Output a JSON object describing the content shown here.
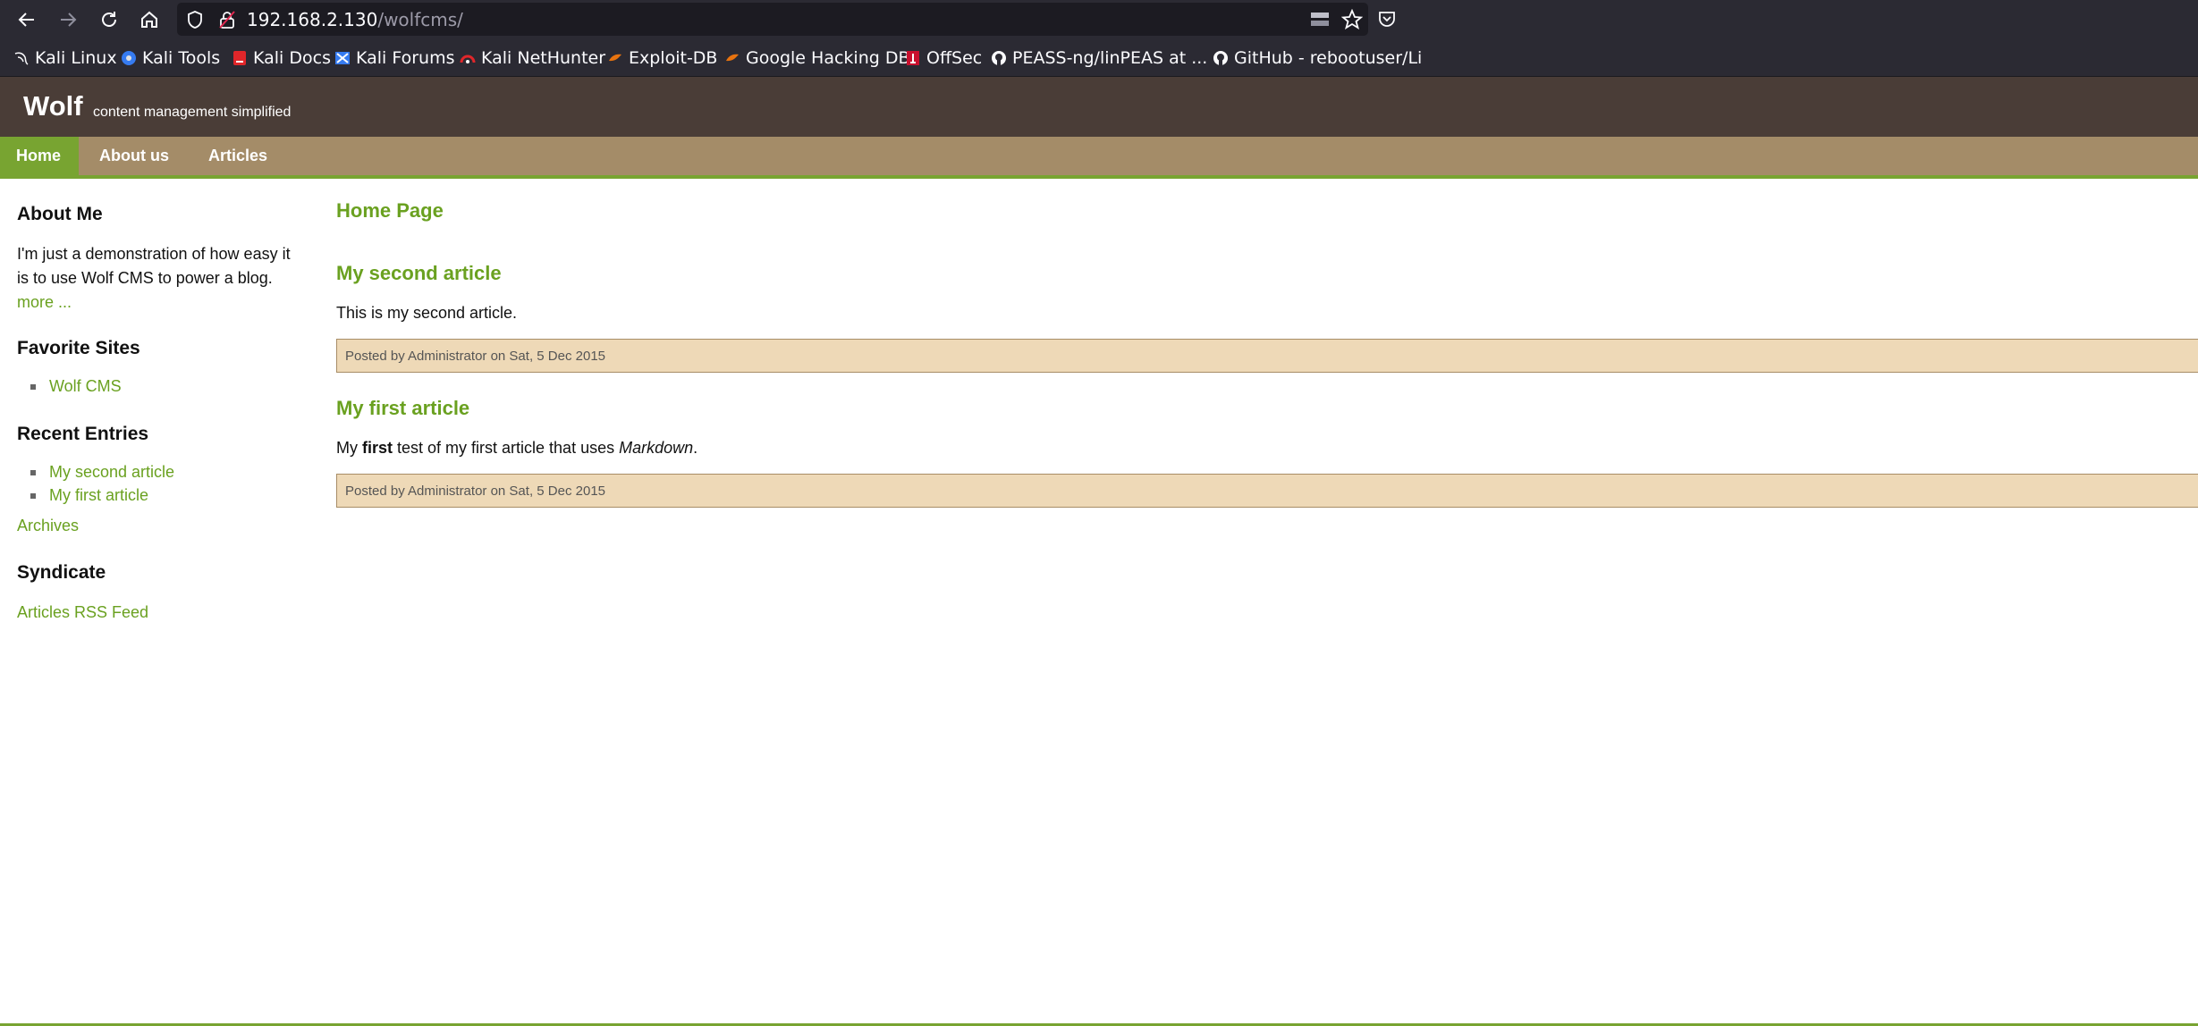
{
  "browser": {
    "url_host": "192.168.2.130",
    "url_path": "/wolfcms/",
    "bookmarks": [
      {
        "label": "Kali Linux",
        "icon": "kali-dragon-icon"
      },
      {
        "label": "Kali Tools",
        "icon": "kali-tools-icon"
      },
      {
        "label": "Kali Docs",
        "icon": "kali-docs-icon"
      },
      {
        "label": "Kali Forums",
        "icon": "kali-forums-icon"
      },
      {
        "label": "Kali NetHunter",
        "icon": "nethunter-icon"
      },
      {
        "label": "Exploit-DB",
        "icon": "exploit-db-icon"
      },
      {
        "label": "Google Hacking DB",
        "icon": "ghdb-icon"
      },
      {
        "label": "OffSec",
        "icon": "offsec-icon"
      },
      {
        "label": "PEASS-ng/linPEAS at ...",
        "icon": "github-icon"
      },
      {
        "label": "GitHub - rebootuser/Li",
        "icon": "github-icon"
      }
    ]
  },
  "site": {
    "title": "Wolf",
    "slogan": "content management simplified",
    "nav": [
      {
        "label": "Home",
        "active": true
      },
      {
        "label": "About us",
        "active": false
      },
      {
        "label": "Articles",
        "active": false
      }
    ]
  },
  "sidebar": {
    "about_heading": "About Me",
    "about_text": "I'm just a demonstration of how easy it is to use Wolf CMS to power a blog.",
    "about_more": "more ...",
    "favorites_heading": "Favorite Sites",
    "favorites": [
      "Wolf CMS"
    ],
    "recent_heading": "Recent Entries",
    "recent": [
      "My second article",
      "My first article"
    ],
    "archives": "Archives",
    "syndicate_heading": "Syndicate",
    "rss": "Articles RSS Feed"
  },
  "content": {
    "page_title": "Home Page",
    "articles": [
      {
        "title": "My second article",
        "body": "This is my second article.",
        "meta": "Posted by Administrator on Sat, 5 Dec 2015"
      },
      {
        "title": "My first article",
        "body_pre": "My ",
        "body_bold": "first",
        "body_mid": " test of my first article that uses ",
        "body_italic": "Markdown",
        "body_post": ".",
        "meta": "Posted by Administrator on Sat, 5 Dec 2015"
      }
    ]
  },
  "colors": {
    "header_bg": "#4a3d37",
    "nav_bg": "#a48c68",
    "accent_green": "#78a431",
    "link_green": "#6aa120",
    "postbar_bg": "#eed9b7"
  }
}
